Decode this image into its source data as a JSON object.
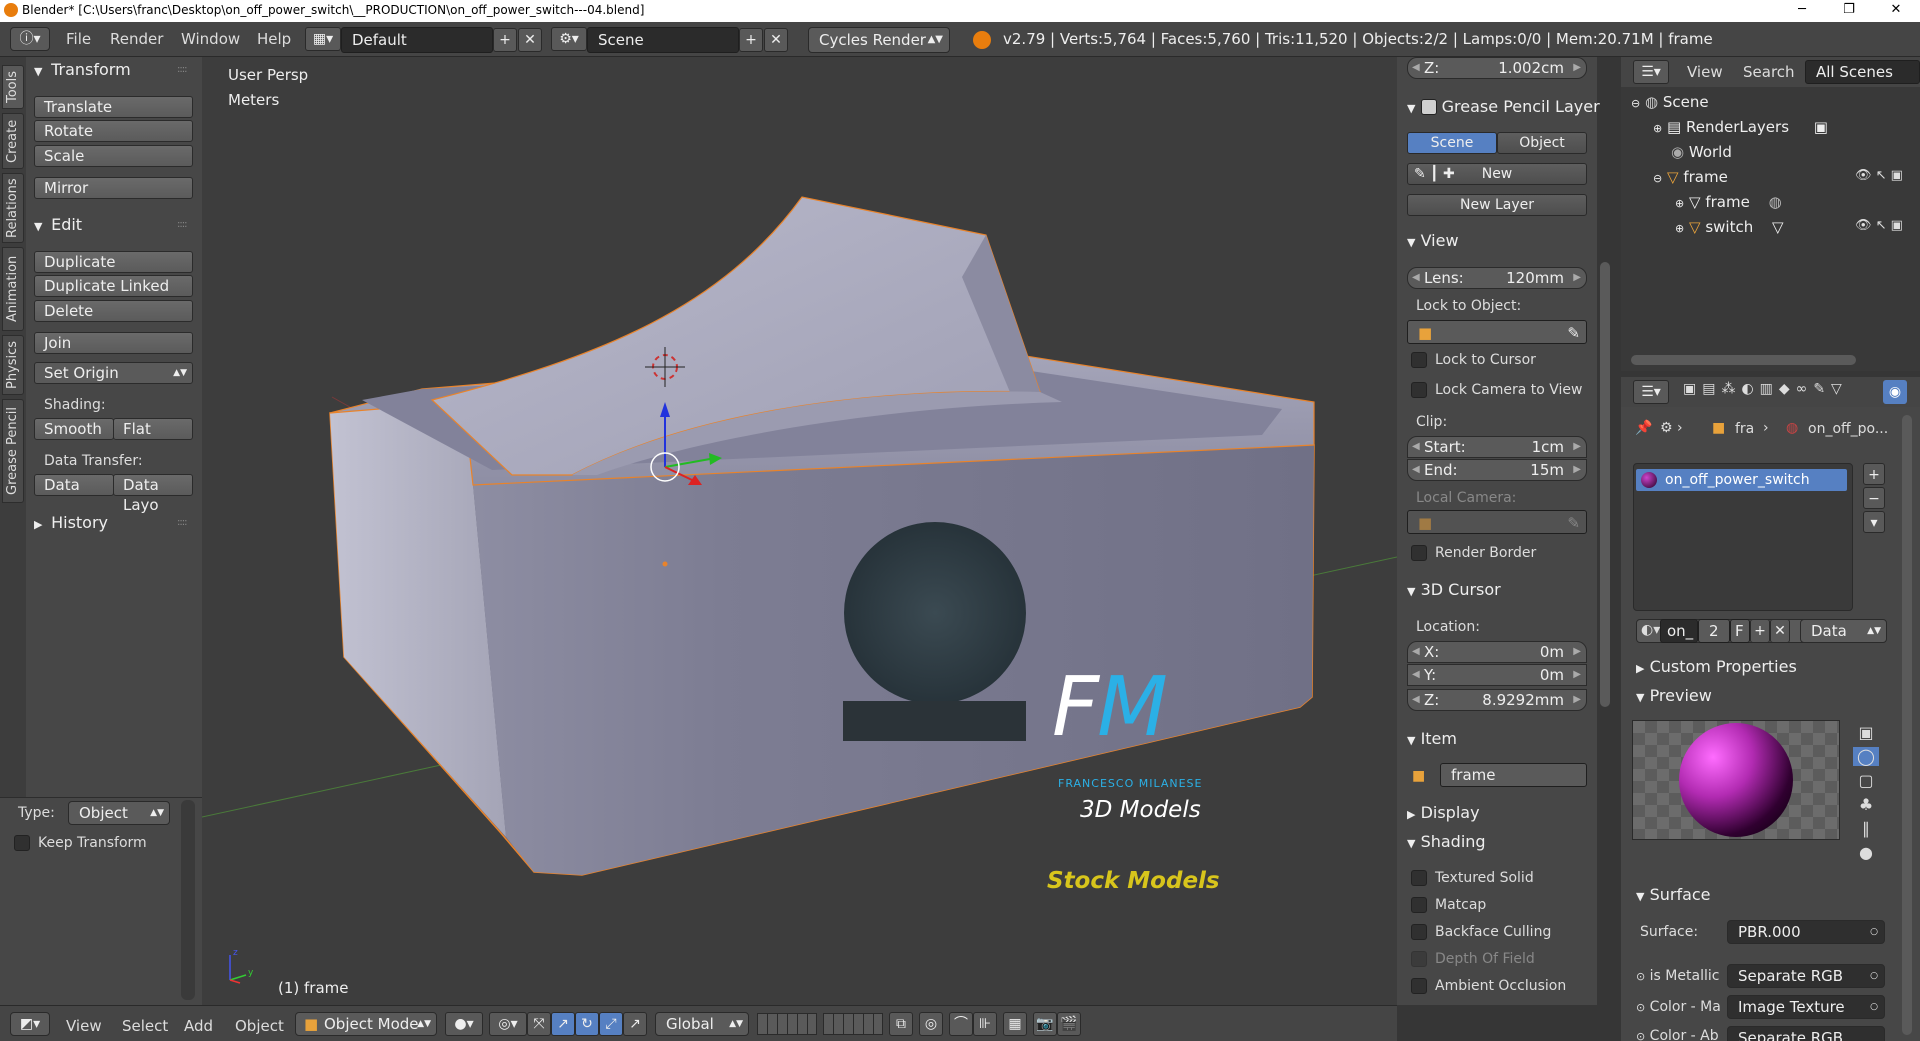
{
  "window": {
    "title": "Blender* [C:\\Users\\franc\\Desktop\\on_off_power_switch\\__PRODUCTION\\on_off_power_switch---04.blend]",
    "min": "─",
    "max": "❐",
    "close": "✕"
  },
  "header": {
    "menus": [
      "File",
      "Render",
      "Window",
      "Help"
    ],
    "layout": "Default",
    "scene": "Scene",
    "engine": "Cycles Render",
    "stats": "v2.79 | Verts:5,764 | Faces:5,760 | Tris:11,520 | Objects:2/2 | Lamps:0/0 | Mem:20.71M | frame"
  },
  "side_tabs": [
    "Tools",
    "Create",
    "Relations",
    "Animation",
    "Physics",
    "Grease Pencil"
  ],
  "tools": {
    "transform_title": "Transform",
    "transform": [
      "Translate",
      "Rotate",
      "Scale"
    ],
    "mirror": "Mirror",
    "edit_title": "Edit",
    "edit": [
      "Duplicate",
      "Duplicate Linked",
      "Delete"
    ],
    "join": "Join",
    "set_origin": "Set Origin",
    "shading_label": "Shading:",
    "smooth": "Smooth",
    "flat": "Flat",
    "data_transfer_label": "Data Transfer:",
    "data": "Data",
    "data_layo": "Data Layo",
    "history_title": "History"
  },
  "operator": {
    "type_label": "Type:",
    "type_value": "Object",
    "keep_transform": "Keep Transform"
  },
  "viewport": {
    "persp": "User Persp",
    "units": "Meters",
    "object_label": "(1) frame",
    "watermark_fm": "FM",
    "watermark_name": "FRANCESCO MILANESE",
    "watermark_3d": "3D Models",
    "watermark_stock": "Stock Models"
  },
  "npanel": {
    "z_top_label": "Z:",
    "z_top_value": "1.002cm",
    "gp_title": "Grease Pencil Layer",
    "gp_scene": "Scene",
    "gp_object": "Object",
    "gp_new": "New",
    "gp_new_layer": "New Layer",
    "view_title": "View",
    "lens_label": "Lens:",
    "lens_value": "120mm",
    "lock_to_object": "Lock to Object:",
    "lock_to_cursor": "Lock to Cursor",
    "lock_camera": "Lock Camera to View",
    "clip_label": "Clip:",
    "clip_start_label": "Start:",
    "clip_start": "1cm",
    "clip_end_label": "End:",
    "clip_end": "15m",
    "local_camera": "Local Camera:",
    "render_border": "Render Border",
    "cursor_title": "3D Cursor",
    "location_label": "Location:",
    "cx_label": "X:",
    "cx": "0m",
    "cy_label": "Y:",
    "cy": "0m",
    "cz_label": "Z:",
    "cz": "8.9292mm",
    "item_title": "Item",
    "item_name": "frame",
    "display_title": "Display",
    "shading_title": "Shading",
    "textured_solid": "Textured Solid",
    "matcap": "Matcap",
    "backface": "Backface Culling",
    "dof": "Depth Of Field",
    "ao": "Ambient Occlusion"
  },
  "outliner": {
    "view": "View",
    "search": "Search",
    "filter": "All Scenes",
    "items": [
      "Scene",
      "RenderLayers",
      "World",
      "frame",
      "frame",
      "switch"
    ]
  },
  "properties": {
    "crumb_obj": "fra",
    "crumb_mat": "on_off_po...",
    "material_slot": "on_off_power_switch",
    "mat_short": "on_",
    "users": "2",
    "fake": "F",
    "link": "Data",
    "custom_props": "Custom Properties",
    "preview": "Preview",
    "surface_title": "Surface",
    "surface_label": "Surface:",
    "surface_value": "PBR.000",
    "metallic_label": "is Metallic",
    "metallic_value": "Separate RGB",
    "colorma_label": "Color - Ma",
    "colorma_value": "Image Texture",
    "colorab_label": "Color - Ab",
    "colorab_value": "Separate RGB"
  },
  "bottom": {
    "menus": [
      "View",
      "Select",
      "Add",
      "Object"
    ],
    "mode": "Object Mode",
    "orientation": "Global"
  }
}
